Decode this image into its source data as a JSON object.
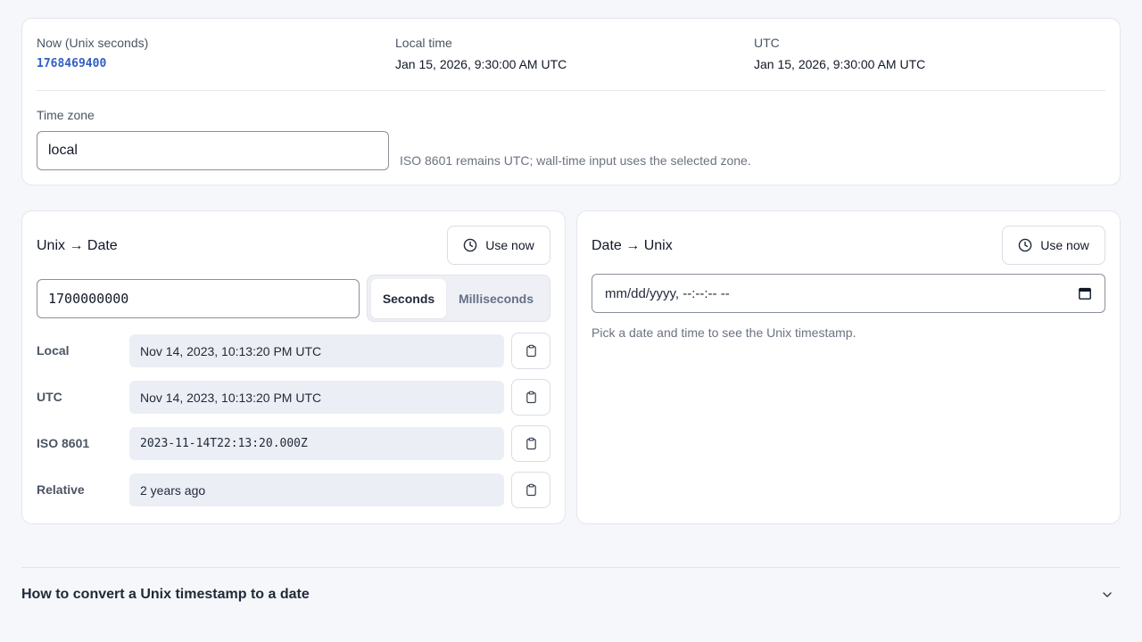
{
  "top": {
    "now_label": "Now (Unix seconds)",
    "now_value": "1768469400",
    "local_label": "Local time",
    "local_value": "Jan 15, 2026, 9:30:00 AM UTC",
    "utc_label": "UTC",
    "utc_value": "Jan 15, 2026, 9:30:00 AM UTC",
    "tz_label": "Time zone",
    "tz_value": "local",
    "tz_hint": "ISO 8601 remains UTC; wall-time input uses the selected zone."
  },
  "unix_to_date": {
    "title": "Unix → Date",
    "use_now": "Use now",
    "input_value": "1700000000",
    "unit_seconds": "Seconds",
    "unit_milliseconds": "Milliseconds",
    "selected_unit": "Seconds",
    "rows": [
      {
        "label": "Local",
        "value": "Nov 14, 2023, 10:13:20 PM UTC"
      },
      {
        "label": "UTC",
        "value": "Nov 14, 2023, 10:13:20 PM UTC"
      },
      {
        "label": "ISO 8601",
        "value": "2023-11-14T22:13:20.000Z"
      },
      {
        "label": "Relative",
        "value": "2 years ago"
      }
    ]
  },
  "date_to_unix": {
    "title": "Date → Unix",
    "use_now": "Use now",
    "input_placeholder": "mm/dd/yyyy, --:--:-- --",
    "hint": "Pick a date and time to see the Unix timestamp."
  },
  "faq": {
    "title": "How to convert a Unix timestamp to a date"
  },
  "icons": {
    "clock": "clock-icon",
    "clipboard": "clipboard-icon",
    "calendar": "calendar-icon",
    "chevron": "chevron-down-icon"
  },
  "colors": {
    "accent": "#2f5fc4",
    "background": "#f6f7fb",
    "field_fill": "#eceef5"
  }
}
